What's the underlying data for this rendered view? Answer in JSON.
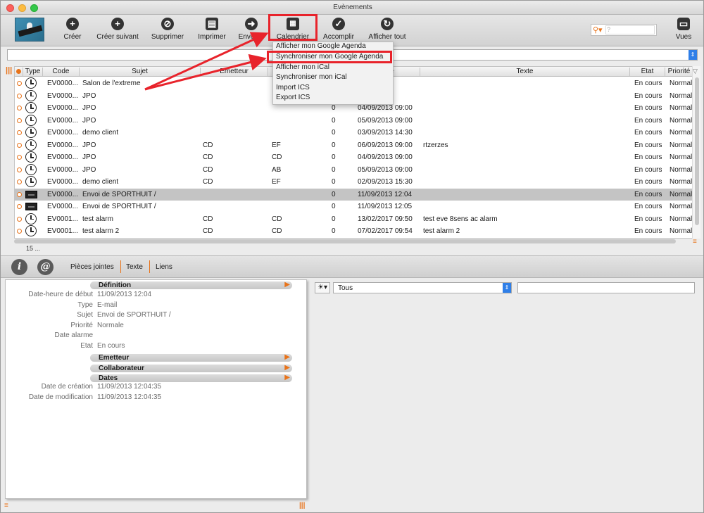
{
  "window": {
    "title": "Evènements"
  },
  "toolbar": {
    "buttons": [
      {
        "label": "Créer",
        "icon": "plus-icon"
      },
      {
        "label": "Créer suivant",
        "icon": "plus-dropdown-icon"
      },
      {
        "label": "Supprimer",
        "icon": "delete-icon"
      },
      {
        "label": "Imprimer",
        "icon": "printer-icon"
      },
      {
        "label": "Envoyer",
        "icon": "send-icon"
      },
      {
        "label": "Calendrier",
        "icon": "calendar-icon"
      },
      {
        "label": "Accomplir",
        "icon": "hammer-icon"
      },
      {
        "label": "Afficher tout",
        "icon": "refresh-icon"
      },
      {
        "label": "Vues",
        "icon": "views-icon"
      }
    ],
    "search_placeholder": "?"
  },
  "calendar_menu": {
    "items": [
      "Afficher mon Google Agenda",
      "Synchroniser mon Google Agenda",
      "Afficher mon iCal",
      "Synchroniser mon iCal",
      "Import ICS",
      "Export ICS"
    ]
  },
  "grid": {
    "columns": [
      "Type",
      "Code",
      "Sujet",
      "Emetteur",
      "re de",
      "Texte",
      "Etat",
      "Priorité"
    ],
    "rows": [
      {
        "type": "clock",
        "code": "EV0000...",
        "sujet": "Salon de l'extreme",
        "emetteur": "",
        "dest": "",
        "num": "",
        "date": "3 09:00",
        "texte": "",
        "etat": "En cours",
        "prio": "Normal"
      },
      {
        "type": "clock",
        "code": "EV0000...",
        "sujet": "JPO",
        "emetteur": "",
        "dest": "",
        "num": "",
        "date": "3 09:00",
        "texte": "",
        "etat": "En cours",
        "prio": "Normal"
      },
      {
        "type": "clock",
        "code": "EV0000...",
        "sujet": "JPO",
        "emetteur": "",
        "dest": "",
        "num": "0",
        "date": "04/09/2013 09:00",
        "texte": "",
        "etat": "En cours",
        "prio": "Normal"
      },
      {
        "type": "clock",
        "code": "EV0000...",
        "sujet": "JPO",
        "emetteur": "",
        "dest": "",
        "num": "0",
        "date": "05/09/2013 09:00",
        "texte": "",
        "etat": "En cours",
        "prio": "Normal"
      },
      {
        "type": "clock",
        "code": "EV0000...",
        "sujet": "demo client",
        "emetteur": "",
        "dest": "",
        "num": "0",
        "date": "03/09/2013 14:30",
        "texte": "",
        "etat": "En cours",
        "prio": "Normal"
      },
      {
        "type": "clock",
        "code": "EV0000...",
        "sujet": "JPO",
        "emetteur": "CD",
        "dest": "EF",
        "num": "0",
        "date": "06/09/2013 09:00",
        "texte": "rtzerzes",
        "etat": "En cours",
        "prio": "Normal"
      },
      {
        "type": "clock",
        "code": "EV0000...",
        "sujet": "JPO",
        "emetteur": "CD",
        "dest": "CD",
        "num": "0",
        "date": "04/09/2013 09:00",
        "texte": "",
        "etat": "En cours",
        "prio": "Normal"
      },
      {
        "type": "clock",
        "code": "EV0000...",
        "sujet": "JPO",
        "emetteur": "CD",
        "dest": "AB",
        "num": "0",
        "date": "05/09/2013 09:00",
        "texte": "",
        "etat": "En cours",
        "prio": "Normal"
      },
      {
        "type": "clock",
        "code": "EV0000...",
        "sujet": "demo client",
        "emetteur": "CD",
        "dest": "EF",
        "num": "0",
        "date": "02/09/2013 15:30",
        "texte": "",
        "etat": "En cours",
        "prio": "Normal"
      },
      {
        "type": "mail",
        "code": "EV0000...",
        "sujet": "Envoi de SPORTHUIT /",
        "emetteur": "",
        "dest": "",
        "num": "0",
        "date": "11/09/2013 12:04",
        "texte": "",
        "etat": "En cours",
        "prio": "Normal",
        "selected": true
      },
      {
        "type": "mail",
        "code": "EV0000...",
        "sujet": "Envoi de SPORTHUIT /",
        "emetteur": "",
        "dest": "",
        "num": "0",
        "date": "11/09/2013 12:05",
        "texte": "",
        "etat": "En cours",
        "prio": "Normal"
      },
      {
        "type": "clock",
        "code": "EV0001...",
        "sujet": "test alarm",
        "emetteur": "CD",
        "dest": "CD",
        "num": "0",
        "date": "13/02/2017 09:50",
        "texte": "test eve 8sens ac alarm",
        "etat": "En cours",
        "prio": "Normal"
      },
      {
        "type": "clock",
        "code": "EV0001...",
        "sujet": "test alarm 2",
        "emetteur": "CD",
        "dest": "CD",
        "num": "0",
        "date": "07/02/2017 09:54",
        "texte": "test alarm 2",
        "etat": "En cours",
        "prio": "Normal"
      }
    ],
    "count": "15 ..."
  },
  "tabs": {
    "items": [
      "Pièces jointes",
      "Texte",
      "Liens"
    ]
  },
  "detail": {
    "sections": {
      "definition": "Définition",
      "emetteur": "Emetteur",
      "collaborateur": "Collaborateur",
      "dates": "Dates"
    },
    "fields_def": [
      {
        "label": "Date-heure de début",
        "value": "11/09/2013 12:04"
      },
      {
        "label": "Type",
        "value": "E-mail"
      },
      {
        "label": "Sujet",
        "value": "Envoi de SPORTHUIT /"
      },
      {
        "label": "Priorité",
        "value": "Normale"
      },
      {
        "label": "Date alarme",
        "value": ""
      },
      {
        "label": "Etat",
        "value": "En cours"
      }
    ],
    "fields_dates": [
      {
        "label": "Date de création",
        "value": "11/09/2013 12:04:35"
      },
      {
        "label": "Date de modification",
        "value": "11/09/2013 12:04:35"
      }
    ]
  },
  "right_panel": {
    "filter_value": "Tous"
  },
  "colors": {
    "accent": "#e8731a",
    "highlight": "#e8232b",
    "select_blue": "#2f7fe8"
  }
}
